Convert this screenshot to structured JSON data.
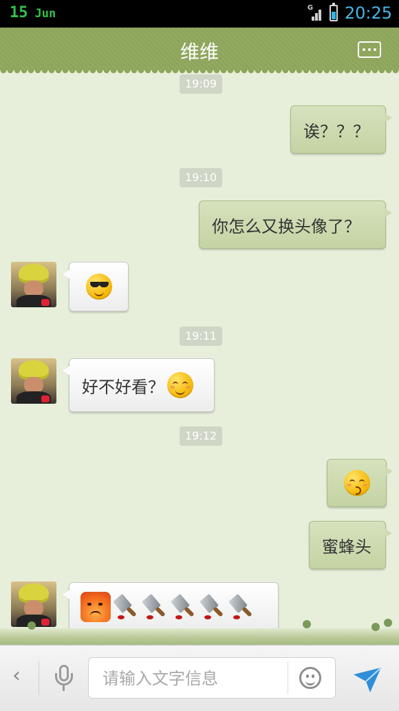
{
  "status_bar": {
    "day": "15",
    "month": "Jun",
    "network": "G",
    "time": "20:25",
    "battery_level": 0.55
  },
  "header": {
    "title": "维维",
    "more_icon": "more-dots-icon"
  },
  "messages": [
    {
      "type": "timestamp",
      "text": "19:09"
    },
    {
      "type": "outgoing",
      "text": "诶？？？"
    },
    {
      "type": "timestamp",
      "text": "19:10"
    },
    {
      "type": "outgoing",
      "text": "你怎么又换头像了？"
    },
    {
      "type": "incoming",
      "emoji": "cool-sunglasses-emoji"
    },
    {
      "type": "timestamp",
      "text": "19:11"
    },
    {
      "type": "incoming",
      "text": "好不好看？",
      "emoji": "shy-smile-emoji"
    },
    {
      "type": "timestamp",
      "text": "19:12"
    },
    {
      "type": "outgoing",
      "emoji": "kiss-emoji"
    },
    {
      "type": "outgoing",
      "text": "蜜蜂头"
    },
    {
      "type": "incoming",
      "emoji": [
        "angry-fire-emoji",
        "bloody-cleaver-emoji",
        "bloody-cleaver-emoji",
        "bloody-cleaver-emoji",
        "bloody-cleaver-emoji",
        "bloody-cleaver-emoji"
      ]
    }
  ],
  "input_bar": {
    "back_icon": "chevron-left-icon",
    "mic_icon": "microphone-icon",
    "placeholder": "请输入文字信息",
    "value": "",
    "emoji_icon": "smiley-icon",
    "send_icon": "send-arrow-icon"
  },
  "colors": {
    "header": "#8da55a",
    "chat_background": "#e7efdb",
    "outgoing_bubble": "#cad8ab",
    "incoming_bubble": "#ffffff",
    "timestamp_pill": "#cfd6c6",
    "status_time": "#46b7ea",
    "send_icon": "#2f8fd8"
  }
}
